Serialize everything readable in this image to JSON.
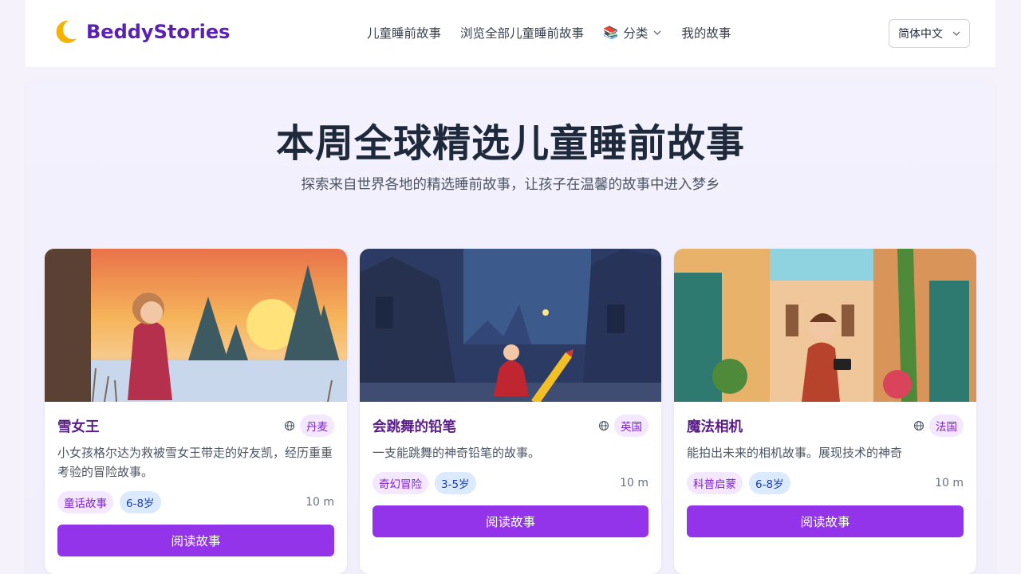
{
  "header": {
    "brand": "BeddyStories",
    "nav": {
      "stories": "儿童睡前故事",
      "browse_all": "浏览全部儿童睡前故事",
      "categories_emoji": "📚",
      "categories": "分类",
      "my_stories": "我的故事"
    },
    "language": "简体中文"
  },
  "hero": {
    "title": "本周全球精选儿童睡前故事",
    "subtitle": "探索来自世界各地的精选睡前故事，让孩子在温馨的故事中进入梦乡"
  },
  "cards": [
    {
      "title": "雪女王",
      "country": "丹麦",
      "description": "小女孩格尔达为救被雪女王带走的好友凯，经历重重考验的冒险故事。",
      "category": "童话故事",
      "age": "6-8岁",
      "duration": "10 m",
      "button": "阅读故事"
    },
    {
      "title": "会跳舞的铅笔",
      "country": "英国",
      "description": "一支能跳舞的神奇铅笔的故事。",
      "category": "奇幻冒险",
      "age": "3-5岁",
      "duration": "10 m",
      "button": "阅读故事"
    },
    {
      "title": "魔法相机",
      "country": "法国",
      "description": "能拍出未来的相机故事。展现技术的神奇",
      "category": "科普启蒙",
      "age": "6-8岁",
      "duration": "10 m",
      "button": "阅读故事"
    }
  ],
  "colors": {
    "brand": "#5b21b6",
    "button": "#9333ea",
    "category_pill": "#f3e8ff",
    "age_pill": "#dbeafe"
  },
  "icons": {
    "logo": "crescent-moon-icon",
    "categories": "books-emoji",
    "dropdown": "chevron-down-icon",
    "origin": "globe-icon"
  }
}
